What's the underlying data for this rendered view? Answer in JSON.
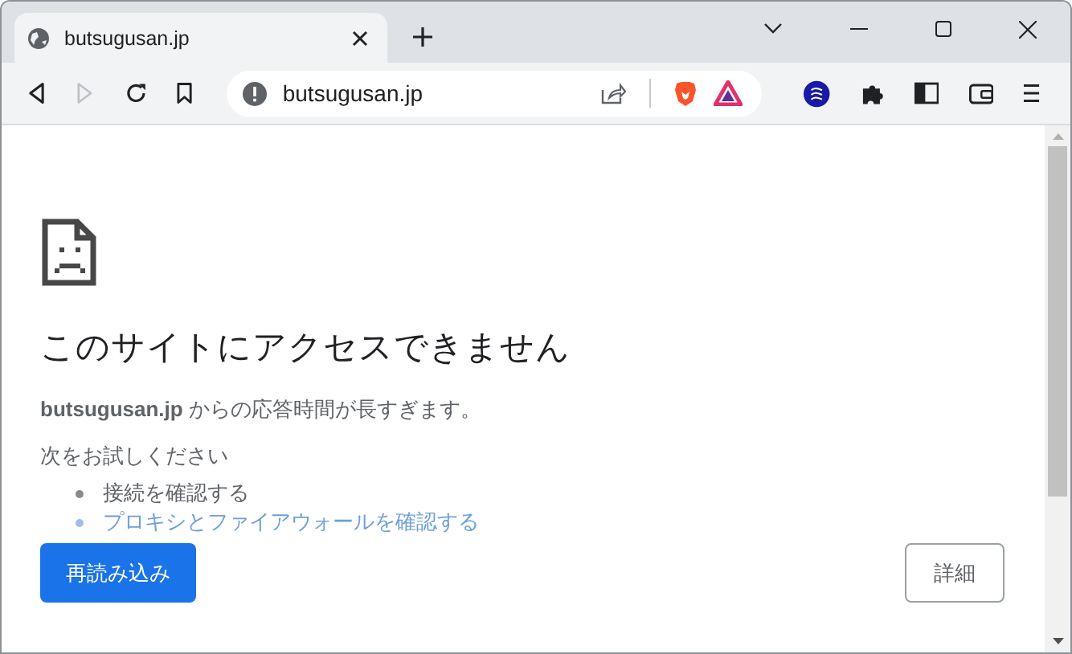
{
  "tab": {
    "title": "butsugusan.jp",
    "selected": true
  },
  "address_bar": {
    "url": "butsugusan.jp"
  },
  "error": {
    "title": "このサイトにアクセスできません",
    "message": "**butsugusan.jp** からの応答時間が長すぎます。",
    "suggestions_heading": "次をお試しください",
    "suggestions": [
      {
        "text": "接続を確認する",
        "faded": false
      },
      {
        "text": "プロキシとファイアウォールを確認する",
        "faded": true
      }
    ]
  },
  "buttons": [
    {
      "label": "再読み込み",
      "kind": "primary"
    },
    {
      "label": "詳細",
      "kind": "secondary"
    }
  ]
}
